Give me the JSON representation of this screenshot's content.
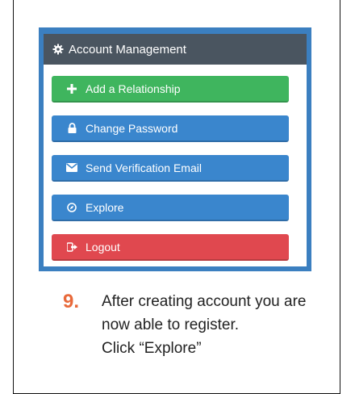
{
  "panel": {
    "title": "Account Management",
    "icon": "gear-icon",
    "accent_color": "#3b7fc0",
    "header_color": "#4a5560"
  },
  "buttons": [
    {
      "label": "Add a Relationship",
      "icon": "plus-icon",
      "color": "#3fb55e"
    },
    {
      "label": "Change Password",
      "icon": "lock-icon",
      "color": "#3a86cd"
    },
    {
      "label": "Send Verification Email",
      "icon": "envelope-icon",
      "color": "#3a86cd"
    },
    {
      "label": "Explore",
      "icon": "compass-icon",
      "color": "#3a86cd"
    },
    {
      "label": "Logout",
      "icon": "sign-out-icon",
      "color": "#e0484f"
    }
  ],
  "step": {
    "number": "9.",
    "number_color": "#e8693a",
    "lines": [
      "After creating account you are",
      "now able to register.",
      "Click “Explore”"
    ]
  }
}
